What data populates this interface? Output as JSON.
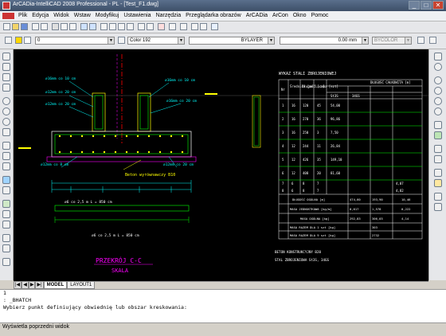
{
  "window": {
    "title": "ArCADia-IntelliCAD 2008 Professional - PL - [Test_F1.dwg]",
    "minimize": "_",
    "maximize": "□",
    "close": "✕"
  },
  "menu": [
    "Plik",
    "Edycja",
    "Widok",
    "Wstaw",
    "Modyfikuj",
    "Ustawienia",
    "Narzędzia",
    "Przeglądarka obrazów",
    "ArCADia",
    "ArCon",
    "Okno",
    "Pomoc"
  ],
  "properties": {
    "layer": "0",
    "color": "Color 192",
    "linetype": "BYLAYER",
    "lineweight": "0.00 mm",
    "plotstyle": "BYCOLOR"
  },
  "drawing": {
    "section_title": "PRZEKRÓJ C-C",
    "section_scale": "SKALA",
    "concrete_label": "Beton wyrównawczy B10",
    "dim_total": "∅6 co 2,5 m L = 850 cm",
    "dim_lower": "∅6 co 2,5 m L = 850 cm",
    "table_title": "WYKAZ STALI ZBROJENIOWEJ",
    "table_sub": "DŁUGOŚĆ CAŁKOWITA [m]",
    "table_head": [
      "Nr",
      "Średnica [mm]",
      "Długość [cm]",
      "Liczba [szt]",
      "St3S",
      "34GS"
    ],
    "table_rows": [
      [
        "1",
        "16",
        "120",
        "45",
        "54,00",
        ""
      ],
      [
        "2",
        "16",
        "270",
        "36",
        "96,86",
        ""
      ],
      [
        "3",
        "16",
        "250",
        "3",
        "7,50",
        ""
      ],
      [
        "4",
        "12",
        "244",
        "11",
        "26,84",
        ""
      ],
      [
        "5",
        "12",
        "426",
        "35",
        "149,10",
        ""
      ],
      [
        "6",
        "12",
        "408",
        "20",
        "81,60",
        ""
      ],
      [
        "7",
        "6",
        "8",
        "7",
        "",
        "4,07"
      ],
      [
        "8",
        "6",
        "8",
        "7",
        "",
        "4,82"
      ]
    ],
    "summary_rows": [
      [
        "DŁUGOŚĆ OGÓLNA [m]",
        "474,60",
        "193,90",
        "",
        "10,46"
      ],
      [
        "MASA JEDNOSTKOWA [kg/m]",
        "0,617",
        "1,578",
        "",
        "0,222"
      ],
      [
        "MASA OGÓLNA [kg]",
        "292,83",
        "306,03",
        "",
        "4,14"
      ],
      [
        "MASA RAZEM DLA 1 szt [kg]",
        "",
        "",
        "303"
      ],
      [
        "MASA RAZEM DLA 9 szt [kg]",
        "",
        "",
        "2732"
      ]
    ],
    "notes": [
      "BETON KONSTRUKCYJNY B20",
      "STAL ZBROJENIOWA St3S, 34GS"
    ]
  },
  "tabs": {
    "model": "MODEL",
    "layout": "LAYOUT1"
  },
  "command": {
    "line1": "1",
    "line2": ": _BHATCH",
    "line3": "Wybierz punkt definiujący obwiednię lub obszar kreskowania:"
  },
  "status": "Wyświetla poprzedni widok",
  "colors": {
    "canvas": "#000000",
    "green": "#00ff00",
    "yellow": "#ffff00",
    "cyan": "#00ffff",
    "red": "#ff0000",
    "magenta": "#ff00ff"
  }
}
